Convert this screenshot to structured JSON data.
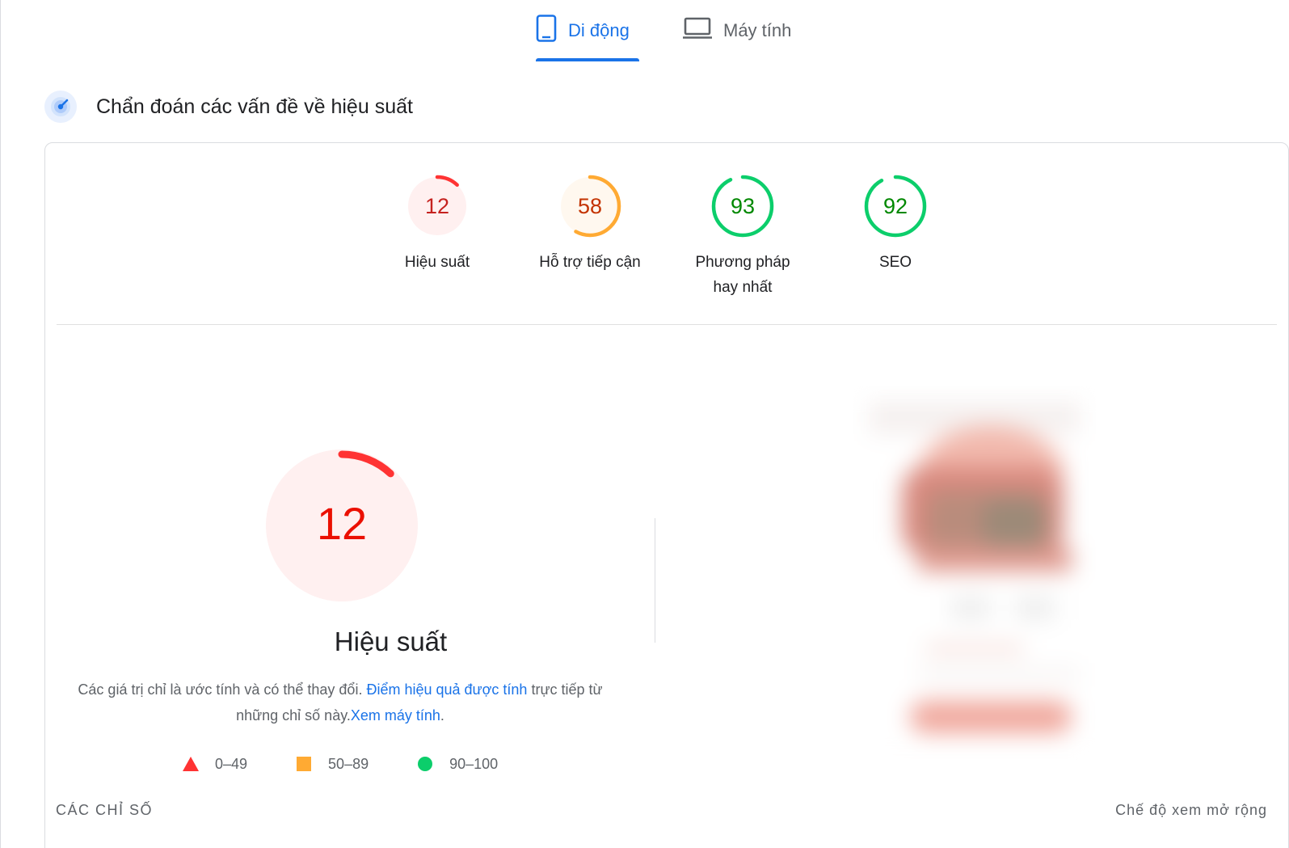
{
  "tabs": [
    {
      "label": "Di động",
      "icon": "smartphone-icon",
      "active": true
    },
    {
      "label": "Máy tính",
      "icon": "laptop-icon",
      "active": false
    }
  ],
  "diagnostics": {
    "title": "Chẩn đoán các vấn đề về hiệu suất",
    "icon": "speed-gauge-icon"
  },
  "scores": [
    {
      "label": "Hiệu suất",
      "value": 12,
      "color": "#ff3333",
      "bg": "#fff0f0",
      "text_color": "#c5221f"
    },
    {
      "label": "Hỗ trợ tiếp cận",
      "value": 58,
      "color": "#ffaa33",
      "bg": "#fff8ef",
      "text_color": "#c33300"
    },
    {
      "label": "Phương pháp hay nhất",
      "value": 93,
      "color": "#0cce6b",
      "bg": "#ffffff",
      "text_color": "#008800"
    },
    {
      "label": "SEO",
      "value": 92,
      "color": "#0cce6b",
      "bg": "#ffffff",
      "text_color": "#008800"
    }
  ],
  "performance": {
    "value": 12,
    "title": "Hiệu suất",
    "desc_text": "Các giá trị chỉ là ước tính và có thể thay đổi.",
    "desc_link1": "Điểm hiệu quả được tính",
    "desc_text2": "trực tiếp từ những chỉ số này.",
    "desc_link2": "Xem máy tính",
    "desc_end": "."
  },
  "legend": [
    {
      "shape": "triangle",
      "range": "0–49",
      "color": "#ff3333"
    },
    {
      "shape": "square",
      "range": "50–89",
      "color": "#ffaa33"
    },
    {
      "shape": "circle",
      "range": "90–100",
      "color": "#0cce6b"
    }
  ],
  "footer": {
    "metrics_label": "CÁC CHỈ SỐ",
    "expand_label": "Chế độ xem mở rộng"
  }
}
